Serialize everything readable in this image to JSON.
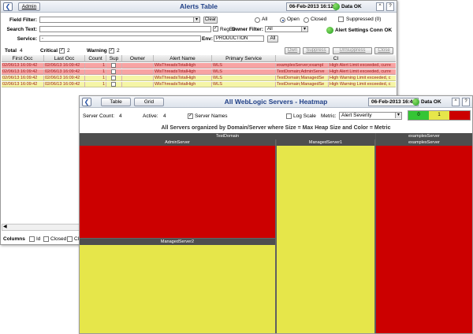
{
  "alerts_window": {
    "admin_label": "Admin",
    "title": "Alerts Table",
    "date": "06-Feb-2013 16:12",
    "data_status": "Data OK",
    "up_btn": "^",
    "help_btn": "?",
    "field_filter_label": "Field Filter:",
    "field_filter_value": "",
    "clear_label": "Clear",
    "search_text_label": "Search Text:",
    "search_text_value": "",
    "regex_label": "RegEx",
    "owner_filter_label": "Owner Filter:",
    "owner_filter_value": "All",
    "service_label": "Service:",
    "service_value": "-",
    "env_label": "Env:",
    "env_value": "PRODUCTION",
    "env_all_label": "All",
    "radio_all": "All",
    "radio_open": "Open",
    "radio_closed": "Closed",
    "suppressed_label": "Suppressed (0)",
    "settings_conn": "Alert Settings Conn OK",
    "total_label": "Total",
    "total_value": "4",
    "critical_label": "Critical",
    "critical_value": "2",
    "warning_label": "Warning",
    "warning_value": "2",
    "own_label": "Own",
    "suppress_label": "Suppress",
    "unsuppress_label": "UnSuppress",
    "close_label": "Close",
    "columns": [
      "First Occ",
      "Last Occ",
      "Count",
      "Sup",
      "Owner",
      "Alert Name",
      "Primary Service",
      "CI"
    ],
    "rows": [
      {
        "first": "02/06/13 16:09:42",
        "last": "02/06/13 16:09:42",
        "count": "1",
        "owner": "",
        "alert": "WlsThreadsTotalHigh",
        "service": "WLS",
        "ci": "examplesServer;exampl",
        "text": "High Alert Limit exceeded, curre",
        "severity": "critical"
      },
      {
        "first": "02/06/13 16:09:42",
        "last": "02/06/13 16:09:42",
        "count": "1",
        "owner": "",
        "alert": "WlsThreadsTotalHigh",
        "service": "WLS",
        "ci": "TestDomain;AdminServe",
        "text": "High Alert Limit exceeded, curre",
        "severity": "critical"
      },
      {
        "first": "02/06/13 16:09:42",
        "last": "02/06/13 16:09:42",
        "count": "1",
        "owner": "",
        "alert": "WlsThreadsTotalHigh",
        "service": "WLS",
        "ci": "TestDomain;ManagedSe",
        "text": "High Warning Limit exceeded, c",
        "severity": "warning"
      },
      {
        "first": "02/06/13 16:09:42",
        "last": "02/06/13 16:09:42",
        "count": "1",
        "owner": "",
        "alert": "WlsThreadsTotalHigh",
        "service": "WLS",
        "ci": "TestDomain;ManagedSe",
        "text": "High Warning Limit exceeded, c",
        "severity": "warning"
      }
    ],
    "columns_label": "Columns",
    "col_id_label": "Id",
    "col_closed_label": "Closed",
    "col_cl_label": "Cl"
  },
  "heatmap_window": {
    "table_btn": "Table",
    "grid_btn": "Grid",
    "title": "All WebLogic Servers - Heatmap",
    "date": "06-Feb-2013 16:43",
    "data_status": "Data OK",
    "up_btn": "^",
    "help_btn": "?",
    "server_count_label": "Server Count:",
    "server_count_value": "4",
    "active_label": "Active:",
    "active_value": "4",
    "server_names_label": "Server Names",
    "log_scale_label": "Log Scale",
    "metric_label": "Metric:",
    "metric_value": "Alert Severity",
    "legend": [
      "0",
      "1",
      "2"
    ],
    "subtitle": "All Servers organized by Domain/Server where Size = Max Heap Size and Color = Metric",
    "domains": [
      "TestDomain",
      "examplesServer"
    ],
    "servers": [
      "AdminServer",
      "ManagedServer1",
      "ManagedServer2",
      "examplesServer"
    ]
  },
  "colors": {
    "critical": "#cc0000",
    "warning": "#e6e64a",
    "normal": "#35c535",
    "row_critical": "#f7a3a3",
    "row_warning": "#f5f5a6",
    "title_blue": "#1f3f86"
  }
}
